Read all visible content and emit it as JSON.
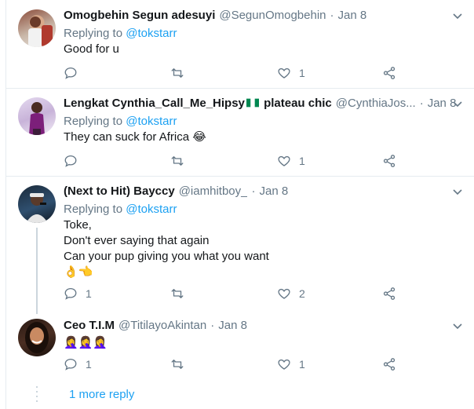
{
  "tweets": [
    {
      "name": "Omogbehin Segun adesuyi",
      "handle": "@SegunOmogbehin",
      "time": "Jan 8",
      "replying_prefix": "Replying to",
      "replying_to": "@tokstarr",
      "lines": [
        "Good for u"
      ],
      "reply_count": "",
      "like_count": "1"
    },
    {
      "name_before_flag": "Lengkat Cynthia_Call_Me_Hipsy",
      "name_after_flag": "plateau chic",
      "handle": "@CynthiaJos...",
      "time": "Jan 8",
      "replying_prefix": "Replying to",
      "replying_to": "@tokstarr",
      "lines": [
        "They can suck for Africa 😂"
      ],
      "reply_count": "",
      "like_count": "1"
    },
    {
      "name": "(Next to Hit) Bayccy",
      "handle": "@iamhitboy_",
      "time": "Jan 8",
      "replying_prefix": "Replying to",
      "replying_to": "@tokstarr",
      "lines": [
        "Toke,",
        "Don't ever saying that again",
        "Can your pup giving you what you want"
      ],
      "emoji_line": "👌👈",
      "reply_count": "1",
      "like_count": "2"
    },
    {
      "name": "Ceo T.I.M",
      "handle": "@TitilayoAkintan",
      "time": "Jan 8",
      "emoji_line": "🤦‍♀️🤦‍♀️🤦‍♀️",
      "reply_count": "1",
      "like_count": "1"
    }
  ],
  "more_replies": "1 more reply",
  "colors": {
    "link": "#1da1f2",
    "muted": "#657786",
    "border": "#e6ecf0",
    "text": "#14171a"
  },
  "icons": [
    "reply-icon",
    "retweet-icon",
    "like-icon",
    "share-icon",
    "caret-down-icon"
  ]
}
